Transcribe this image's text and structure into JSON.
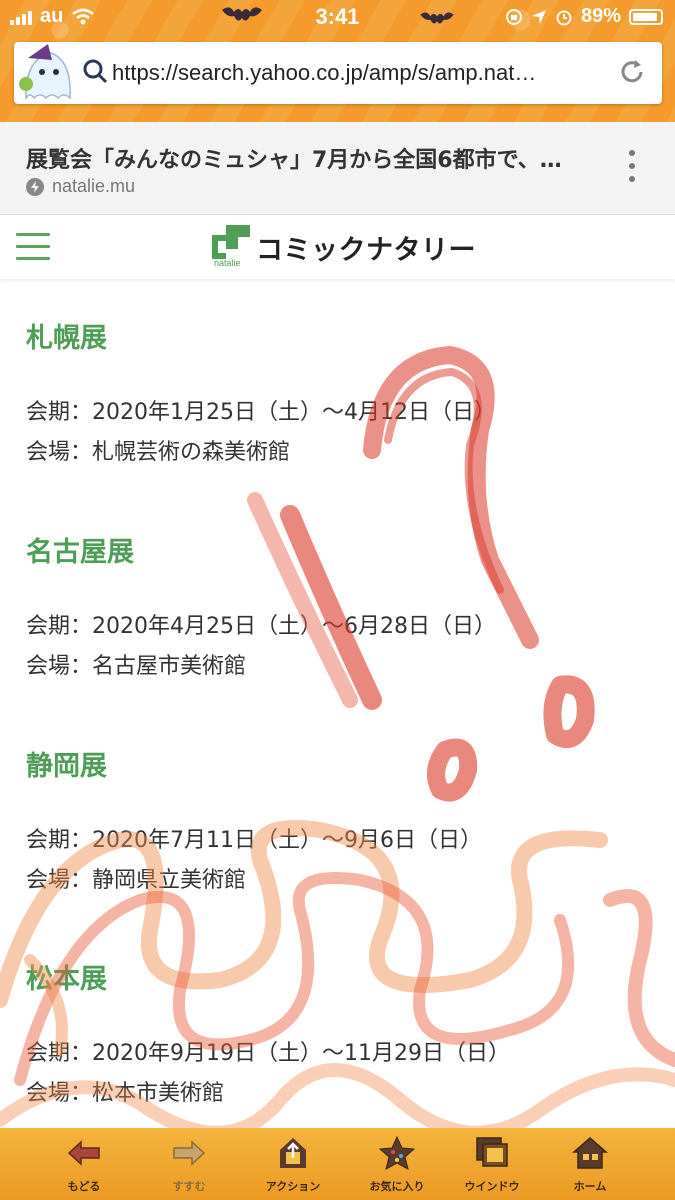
{
  "status_bar": {
    "carrier": "au",
    "time": "3:41",
    "battery": "89%"
  },
  "url_bar": {
    "url": "https://search.yahoo.co.jp/amp/s/amp.nat…"
  },
  "page_header": {
    "title": "展覧会「みんなのミュシャ」7月から全国6都市で、…",
    "domain": "natalie.mu"
  },
  "site": {
    "logo_small": "natalie",
    "logo_text": "コミックナタリー"
  },
  "venues": [
    {
      "title": "札幌展",
      "period": "会期：2020年1月25日（土）〜4月12日（日）",
      "place": "会場：札幌芸術の森美術館"
    },
    {
      "title": "名古屋展",
      "period": "会期：2020年4月25日（土）〜6月28日（日）",
      "place": "会場：名古屋市美術館"
    },
    {
      "title": "静岡展",
      "period": "会期：2020年7月11日（土）〜9月6日（日）",
      "place": "会場：静岡県立美術館"
    },
    {
      "title": "松本展",
      "period": "会期：2020年9月19日（土）〜11月29日（日）",
      "place": "会場：松本市美術館"
    }
  ],
  "toolbar": {
    "back": "もどる",
    "forward": "すすむ",
    "action": "アクション",
    "bookmarks": "お気に入り",
    "window": "ウインドウ",
    "home": "ホーム"
  },
  "colors": {
    "accent_green": "#4e9e58",
    "header_orange": "#f59a2c",
    "toolbar_orange": "#f0a830",
    "doodle_red": "#d8382a",
    "doodle_orange": "#f08a4a"
  }
}
